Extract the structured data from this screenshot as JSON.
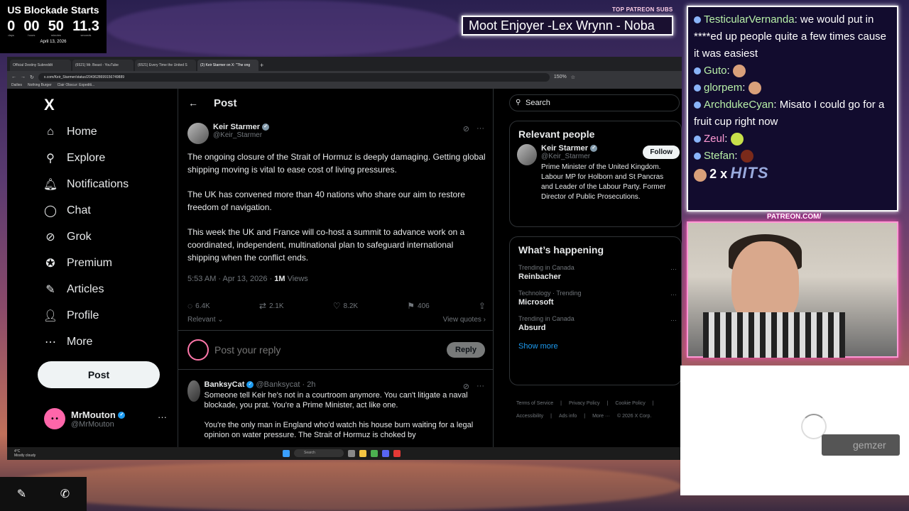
{
  "countdown": {
    "title": "US Blockade Starts",
    "days": "0",
    "hours": "00",
    "minutes": "50",
    "seconds": "11.3",
    "days_label": "days",
    "hours_label": "hours",
    "minutes_label": "minutes",
    "seconds_label": "seconds",
    "date": "April 13, 2026"
  },
  "patreon": {
    "label": "TOP PATREON SUBS",
    "ticker": "Moot Enjoyer -Lex Wrynn -  Noba"
  },
  "browser": {
    "tabs": [
      {
        "label": "Official Destiny Subreddit"
      },
      {
        "label": "(6521) Mr. Beast - YouTube"
      },
      {
        "label": "(6521) Every Time the United S"
      },
      {
        "label": "(2) Keir Starmer on X: \"The ong"
      }
    ],
    "url": "x.com/Keir_Starmer/status/2043628699156749889",
    "zoom": "150%",
    "bookmarks": [
      "Dailies",
      "Nothing Burger",
      "Clair Obscur: Expediti..."
    ]
  },
  "nav": {
    "logo": "X",
    "items": [
      {
        "label": "Home"
      },
      {
        "label": "Explore"
      },
      {
        "label": "Notifications",
        "badge": "3"
      },
      {
        "label": "Chat"
      },
      {
        "label": "Grok"
      },
      {
        "label": "Premium"
      },
      {
        "label": "Articles"
      },
      {
        "label": "Profile"
      },
      {
        "label": "More"
      }
    ],
    "post_button": "Post",
    "user_name": "MrMouton",
    "user_handle": "@MrMouton"
  },
  "post": {
    "header": "Post",
    "author_name": "Keir Starmer",
    "author_handle": "@Keir_Starmer",
    "paragraphs": [
      "The ongoing closure of the Strait of Hormuz is deeply damaging. Getting global shipping moving is vital to ease cost of living pressures.",
      "The UK has convened more than 40 nations who share our aim to restore freedom of navigation.",
      "This week the UK and France will co-host a summit to advance work on a coordinated, independent, multinational plan to safeguard international shipping when the conflict ends."
    ],
    "time": "5:53 AM · Apr 13, 2026 · ",
    "views": "1M",
    "views_label": " Views",
    "replies": "6.4K",
    "reposts": "2.1K",
    "likes": "8.2K",
    "bookmarks": "406",
    "sort": "Relevant",
    "view_quotes": "View quotes",
    "reply_placeholder": "Post your reply",
    "reply_button": "Reply"
  },
  "comment": {
    "name": "BanksyCat",
    "handle": "@Banksycat",
    "time": "· 2h",
    "paragraphs": [
      "Someone tell Keir he's not in a courtroom anymore. You can't litigate a naval blockade, you prat. You're a Prime Minister, act like one.",
      "You're the only man in England who'd watch his house burn waiting for a legal opinion on water pressure. The Strait of Hormuz is choked by"
    ]
  },
  "right": {
    "search_placeholder": "Search",
    "relevant_title": "Relevant people",
    "rp_name": "Keir Starmer",
    "rp_handle": "@Keir_Starmer",
    "rp_follow": "Follow",
    "rp_bio": "Prime Minister of the United Kingdom. Labour MP for Holborn and St Pancras and Leader of the Labour Party. Former Director of Public Prosecutions.",
    "happening_title": "What’s happening",
    "trends": [
      {
        "context": "Trending in Canada",
        "topic": "Reinbacher"
      },
      {
        "context": "Technology · Trending",
        "topic": "Microsoft"
      },
      {
        "context": "Trending in Canada",
        "topic": "Absurd"
      }
    ],
    "show_more": "Show more",
    "footer": [
      "Terms of Service",
      "|",
      "Privacy Policy",
      "|",
      "Cookie Policy",
      "|",
      "Accessibility",
      "|",
      "Ads info",
      "|",
      "More ···",
      "© 2026 X Corp."
    ]
  },
  "taskbar": {
    "weather_temp": "4°C",
    "weather_desc": "Mostly cloudy",
    "search": "Search"
  },
  "chat": {
    "messages": [
      {
        "user": "TesticularVernanda",
        "text": ": we would put in ****ed up people quite a few times cause it was easiest"
      },
      {
        "user": "Guto",
        "text": ":"
      },
      {
        "user": "glorpem",
        "text": ":"
      },
      {
        "user": "ArchdukeCyan",
        "text": ": Misato  I could go for a fruit cup right now"
      },
      {
        "user": "Zeul",
        "text": ":"
      },
      {
        "user": "Stefan",
        "text": ":"
      }
    ],
    "combo_multiplier": "2 x",
    "combo_text": "HITS"
  },
  "cam": {
    "patreon_url": "PATREON.COM/"
  },
  "gemzer": "gemzer"
}
